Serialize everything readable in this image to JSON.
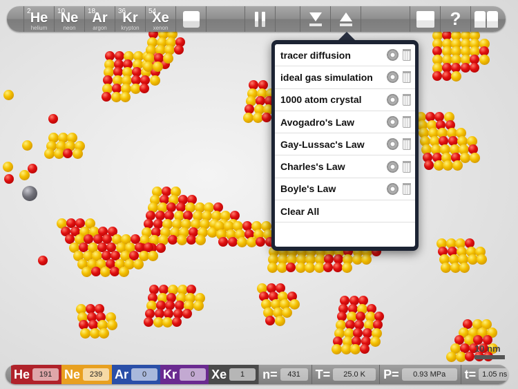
{
  "toolbar": {
    "elements": [
      {
        "number": "2",
        "symbol": "He",
        "name": "helium"
      },
      {
        "number": "10",
        "symbol": "Ne",
        "name": "neon"
      },
      {
        "number": "18",
        "symbol": "Ar",
        "name": "argon"
      },
      {
        "number": "36",
        "symbol": "Kr",
        "name": "krypton"
      },
      {
        "number": "54",
        "symbol": "Xe",
        "name": "xenon"
      }
    ],
    "help_label": "?"
  },
  "saved_menu": {
    "items": [
      {
        "label": "tracer diffusion"
      },
      {
        "label": "ideal gas simulation"
      },
      {
        "label": "1000 atom crystal"
      },
      {
        "label": "Avogadro's Law"
      },
      {
        "label": "Gay-Lussac's Law"
      },
      {
        "label": "Charles's Law"
      },
      {
        "label": "Boyle's Law"
      }
    ],
    "clear_all_label": "Clear All"
  },
  "scale_bar": {
    "label": "10 nm"
  },
  "status": {
    "counts": [
      {
        "symbol": "He",
        "value": "191",
        "color": "#b0222a"
      },
      {
        "symbol": "Ne",
        "value": "239",
        "color": "#e8a020"
      },
      {
        "symbol": "Ar",
        "value": "0",
        "color": "#2a4fa8"
      },
      {
        "symbol": "Kr",
        "value": "0",
        "color": "#6a2a90"
      },
      {
        "symbol": "Xe",
        "value": "1",
        "color": "#4a4a4a"
      }
    ],
    "n_label": "n=",
    "n_value": "431",
    "T_label": "T=",
    "T_value": "25.0 K",
    "P_label": "P=",
    "P_value": "0.93 MPa",
    "t_label": "t=",
    "t_value": "1.05  ns"
  }
}
